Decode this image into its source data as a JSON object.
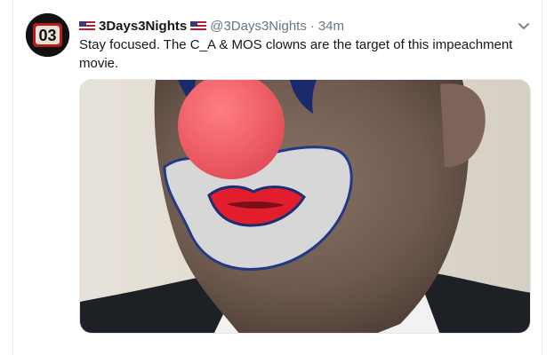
{
  "tweet": {
    "avatar_text": "03",
    "display_name": "3Days3Nights",
    "handle": "@3Days3Nights",
    "separator": "·",
    "time": "34m",
    "text": "Stay focused. The C_A & MOS clowns are the target of this impeachment movie."
  },
  "icons": {
    "flag": "us-flag-icon",
    "menu": "chevron-down-icon"
  },
  "colors": {
    "name": "#14171a",
    "meta": "#657786",
    "border": "#e6ecf0"
  }
}
